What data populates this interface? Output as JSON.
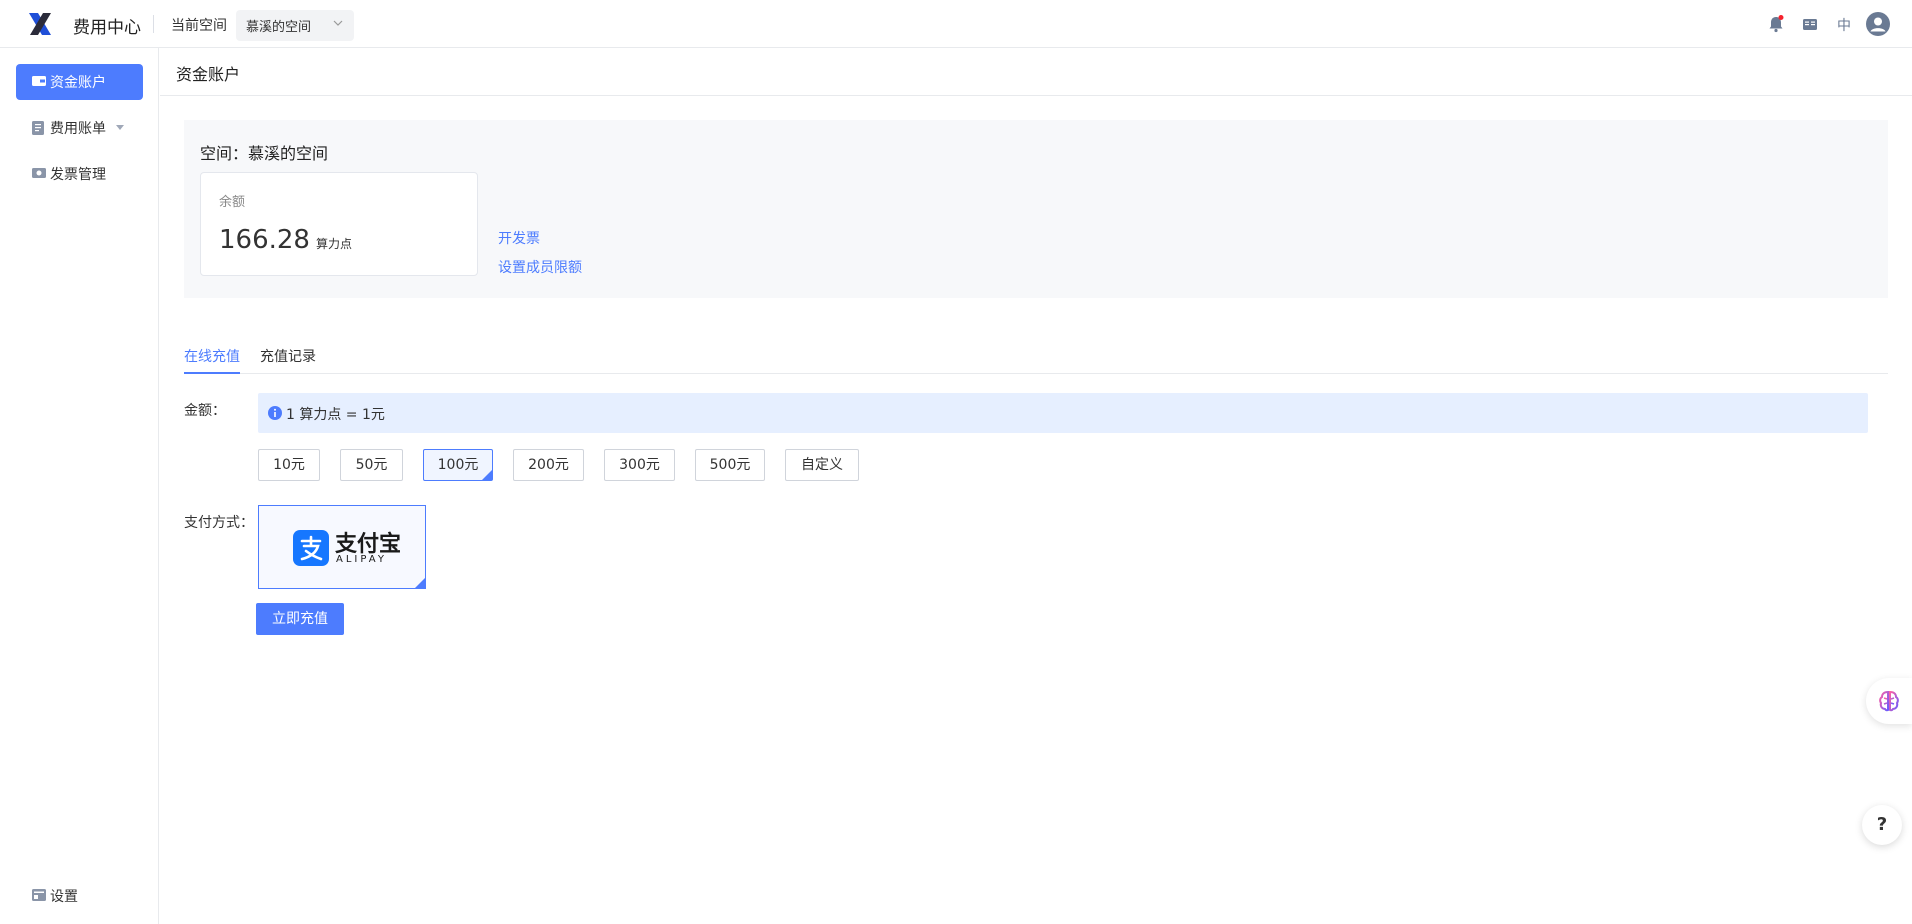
{
  "header": {
    "app_title": "费用中心",
    "space_label": "当前空间",
    "space_value": "慕溪的空间",
    "lang_label": "中"
  },
  "sidebar": {
    "items": [
      {
        "label": "资金账户",
        "icon": "wallet-icon",
        "active": true
      },
      {
        "label": "费用账单",
        "icon": "bill-icon",
        "active": false
      },
      {
        "label": "发票管理",
        "icon": "invoice-icon",
        "active": false
      }
    ],
    "settings_label": "设置"
  },
  "content": {
    "title": "资金账户",
    "space_name": "空间：慕溪的空间",
    "balance_label": "余额",
    "balance_value": "166.28",
    "balance_unit": "算力点",
    "link_invoice": "开发票",
    "link_limit": "设置成员限额"
  },
  "tabs": [
    {
      "label": "在线充值",
      "active": true
    },
    {
      "label": "充值记录",
      "active": false
    }
  ],
  "recharge": {
    "amount_label": "金额：",
    "rate_info": "1 算力点 = 1元",
    "amounts": [
      "10元",
      "50元",
      "100元",
      "200元",
      "300元",
      "500元",
      "自定义"
    ],
    "selected_amount": "100元",
    "pay_label": "支付方式：",
    "pay_method_name": "支付宝",
    "pay_method_sub": "ALIPAY",
    "submit_label": "立即充值"
  },
  "floating": {
    "help_label": "?"
  },
  "colors": {
    "accent": "#4d7cfe",
    "alipay_blue": "#1677ff",
    "notification_dot": "#f5222d"
  }
}
